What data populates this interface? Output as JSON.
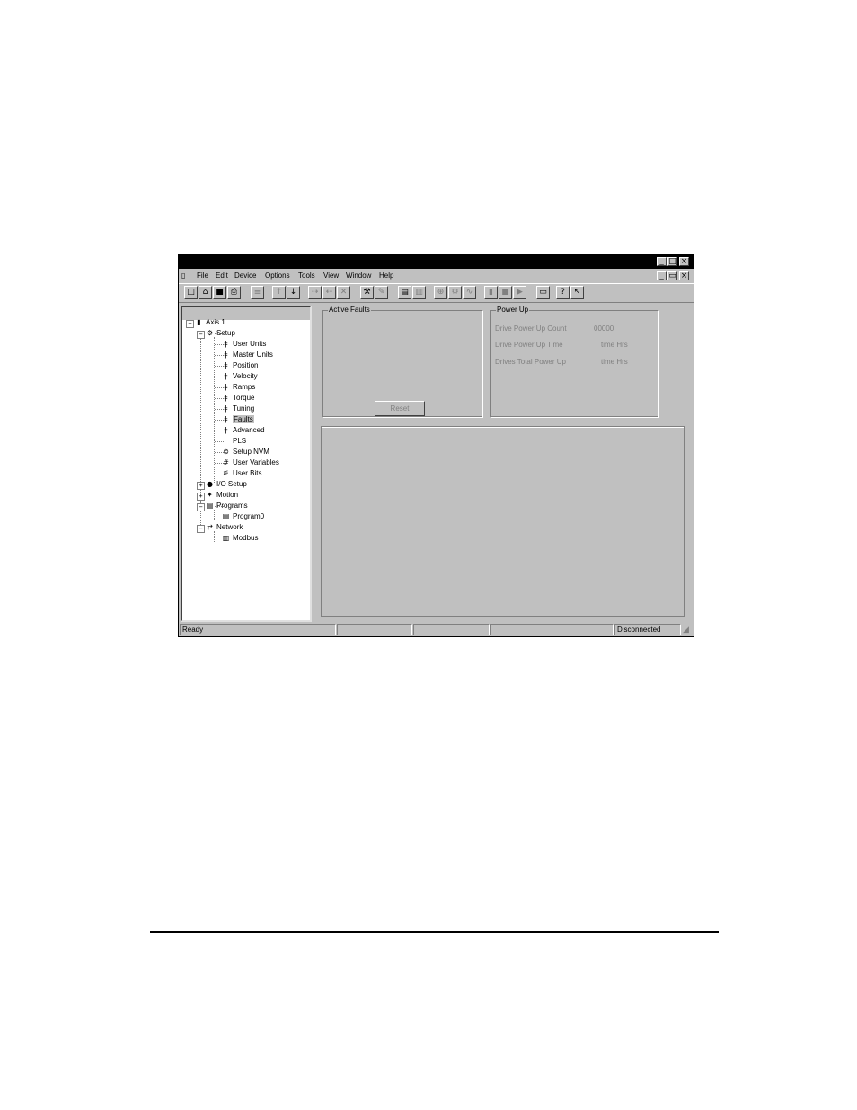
{
  "menu": [
    "File",
    "Edit",
    "Device",
    "Options",
    "Tools",
    "View",
    "Window",
    "Help"
  ],
  "window_controls": {
    "minimize": "_",
    "maximize": "□",
    "close": "×",
    "restore": "▭"
  },
  "tree": {
    "root": "Axis 1",
    "setup": "Setup",
    "setup_children": [
      "User Units",
      "Master Units",
      "Position",
      "Velocity",
      "Ramps",
      "Torque",
      "Tuning",
      "Faults",
      "Advanced"
    ],
    "pls": "PLS",
    "setup_nvm": "Setup NVM",
    "user_variables": "User Variables",
    "user_bits": "User Bits",
    "io_setup": "I/O Setup",
    "motion": "Motion",
    "programs": "Programs",
    "program0": "Program0",
    "network": "Network",
    "modbus": "Modbus",
    "selected": "Faults"
  },
  "active_faults": {
    "title": "Active Faults",
    "reset_label": "Reset"
  },
  "power_up": {
    "title": "Power Up",
    "count_label": "Drive Power Up Count",
    "count_value": "00000",
    "time_label": "Drive Power Up Time",
    "time_value": "time  Hrs",
    "total_label": "Drives Total Power Up",
    "total_value": "time  Hrs"
  },
  "status": {
    "left": "Ready",
    "right": "Disconnected"
  },
  "icons": {
    "grip": "◢",
    "toolbar": [
      "new-file-icon",
      "open-folder-icon",
      "save-icon",
      "print-icon",
      "properties-icon",
      "upload-icon",
      "download-icon",
      "connect-icon",
      "disconnect-icon",
      "cancel-icon",
      "compile-icon",
      "edit-icon",
      "watch-icon",
      "list-icon",
      "zoom-icon",
      "tool-icon",
      "chart-icon",
      "info-icon",
      "stop-icon",
      "run-icon",
      "window-icon",
      "help-icon",
      "context-help-icon"
    ]
  }
}
